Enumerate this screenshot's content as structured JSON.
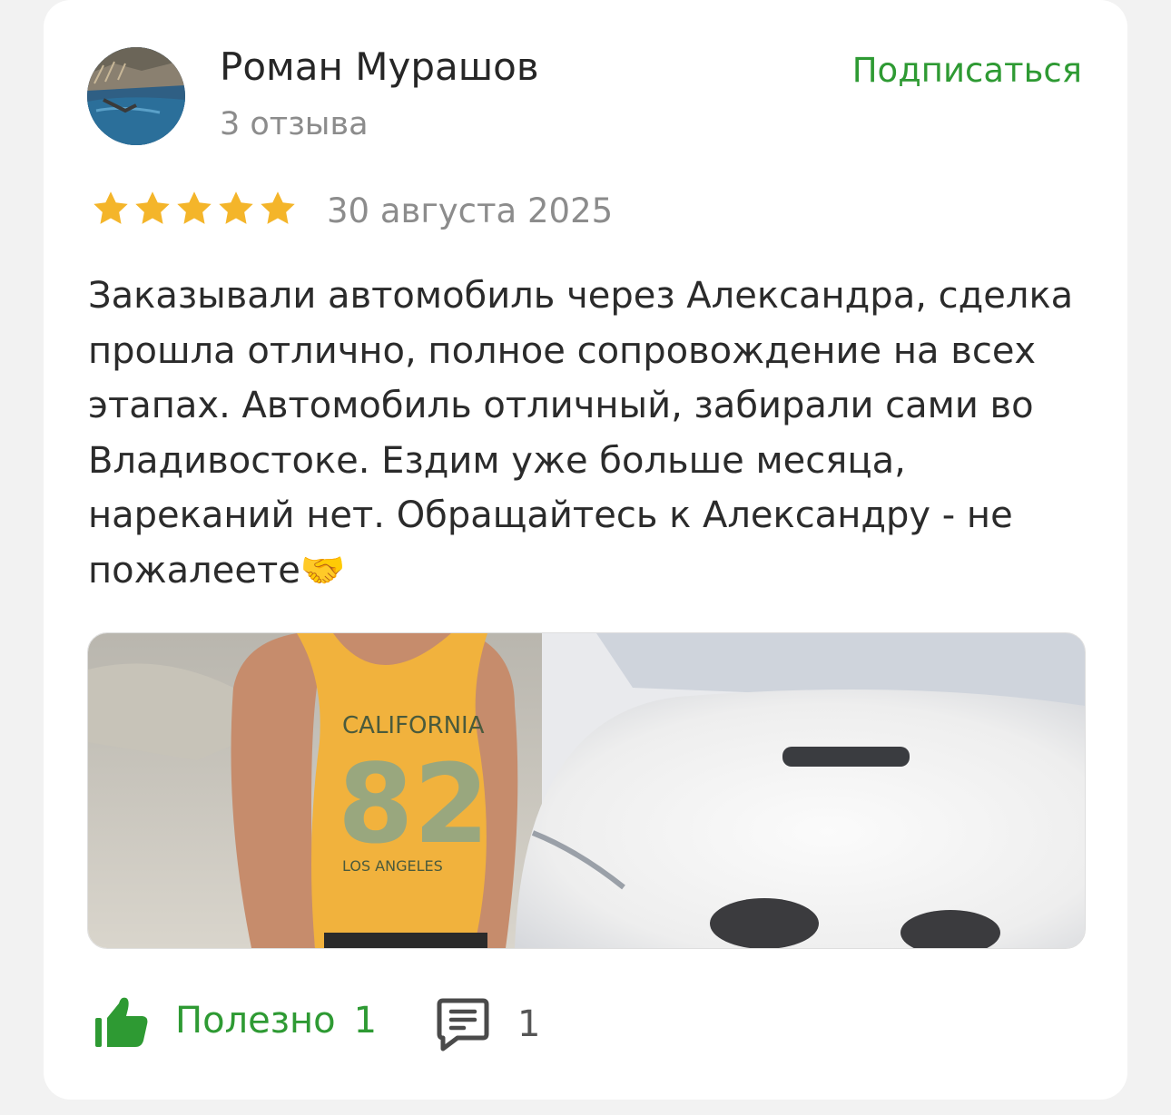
{
  "review": {
    "author_name": "Роман Мурашов",
    "author_reviews": "3 отзыва",
    "subscribe_label": "Подписаться",
    "rating": 5,
    "rating_max": 5,
    "date": "30 августа 2025",
    "text": "Заказывали автомобиль через Александра, сделка прошла отлично, полное сопровождение на всех этапах. Автомобиль отличный, забирали сами во Владивостоке. Ездим уже больше месяца, нареканий нет. Обращайтесь к Александру - не пожалеете🤝",
    "photo_shirt_text_top": "CALIFORNIA",
    "photo_shirt_text_number": "82",
    "photo_shirt_text_bottom": "LOS ANGELES"
  },
  "actions": {
    "useful_label": "Полезно",
    "useful_count": "1",
    "comments_count": "1"
  },
  "colors": {
    "accent_green": "#2e9a33",
    "star_gold": "#f4b52a",
    "muted_text": "#8c8c8c"
  },
  "icons": [
    "thumbs-up-icon",
    "comment-icon",
    "star-icon"
  ]
}
